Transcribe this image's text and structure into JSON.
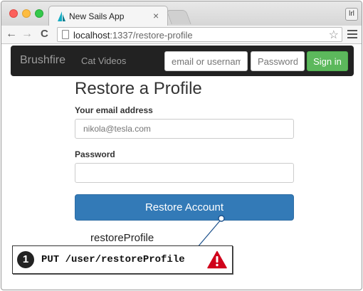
{
  "browser": {
    "tab_title": "New Sails App",
    "tab_close": "×",
    "ext_button": "lrl",
    "url_host": "localhost",
    "url_path": ":1337/restore-profile",
    "back_glyph": "←",
    "forward_glyph": "→",
    "reload_glyph": "C",
    "star_glyph": "☆"
  },
  "navbar": {
    "brand": "Brushfire",
    "link": "Cat Videos",
    "username_placeholder": "email or username",
    "password_placeholder": "Password",
    "signin_label": "Sign in"
  },
  "form": {
    "title": "Restore a Profile",
    "email_label": "Your email address",
    "email_placeholder": "nikola@tesla.com",
    "password_label": "Password",
    "submit_label": "Restore Account"
  },
  "output": {
    "text": "restoreProfile"
  },
  "callout": {
    "number": "1",
    "text": "PUT /user/restoreProfile",
    "warning_icon": "warning-icon"
  },
  "colors": {
    "navbar_bg": "#222222",
    "signin_green": "#5cb85c",
    "primary_blue": "#337ab7",
    "callout_line": "#1a4f8a",
    "warning_red": "#d0021b"
  }
}
